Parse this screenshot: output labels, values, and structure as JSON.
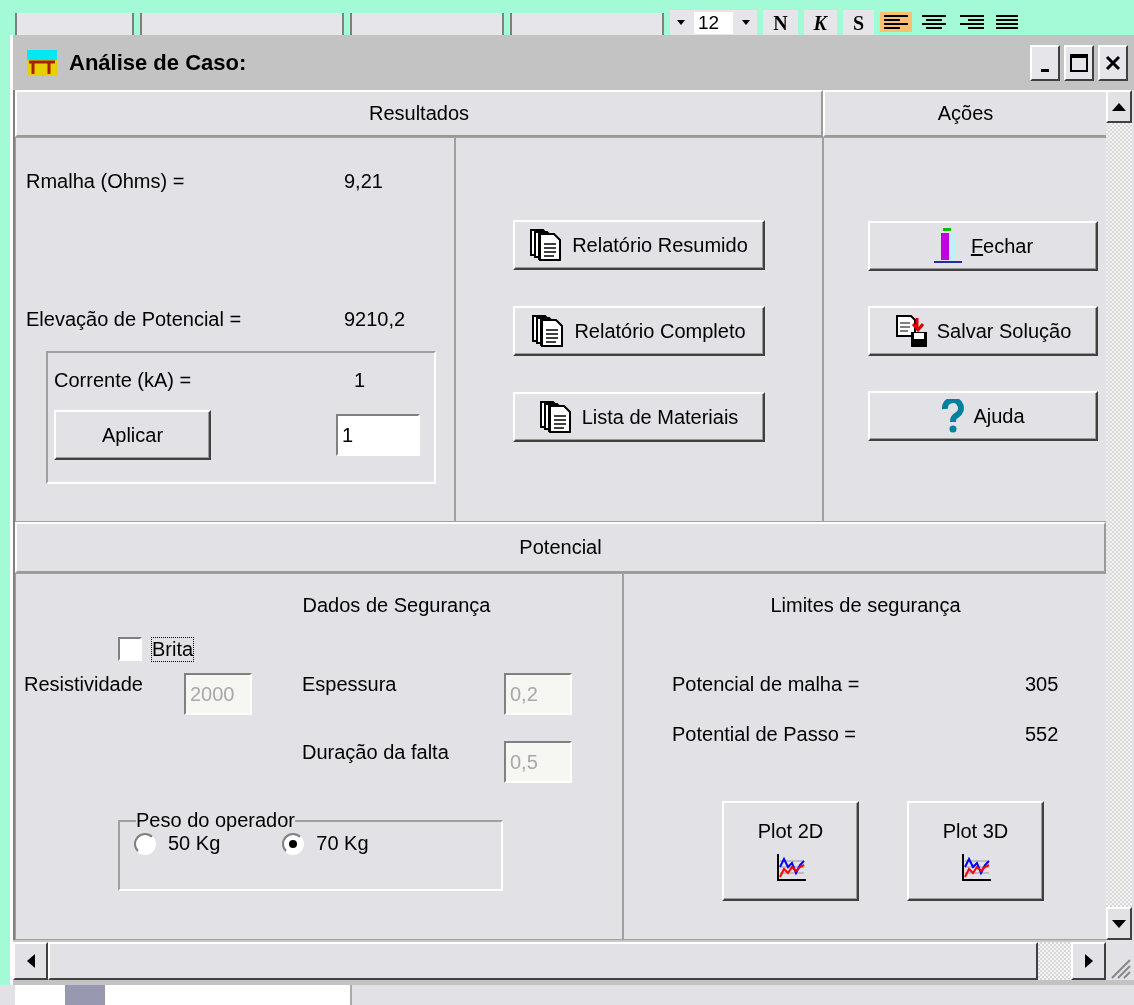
{
  "toolbar": {
    "font_size": "12",
    "bold": "N",
    "italic": "K",
    "underline": "S"
  },
  "window": {
    "title": "Análise de Caso:"
  },
  "resultados": {
    "header": "Resultados",
    "rows": [
      {
        "label": "Rmalha (Ohms) =",
        "value": "9,21"
      },
      {
        "label": "Elevação de Potencial =",
        "value": "9210,2"
      }
    ],
    "corrente": {
      "label": "Corrente (kA) =",
      "value": "1",
      "apply_button": "Aplicar",
      "input_value": "1"
    },
    "report_buttons": [
      "Relatório Resumido",
      "Relatório Completo",
      "Lista de Materiais"
    ]
  },
  "acoes": {
    "header": "Ações",
    "buttons": [
      {
        "kind": "close",
        "key": "F",
        "rest": "echar"
      },
      {
        "kind": "save",
        "rest": "Salvar Solução"
      },
      {
        "kind": "help",
        "rest": "Ajuda"
      }
    ]
  },
  "potencial": {
    "header": "Potencial",
    "dados": {
      "title": "Dados de Segurança",
      "brita": {
        "label": "Brita",
        "checked": false
      },
      "fields": [
        {
          "label": "Resistividade",
          "value": "2000",
          "disabled": true
        },
        {
          "label": "Espessura",
          "value": "0,2",
          "disabled": true
        },
        {
          "label": "Duração da falta",
          "value": "0,5",
          "disabled": true
        }
      ],
      "peso": {
        "legend": "Peso do operador",
        "options": [
          {
            "label": "50 Kg",
            "selected": false
          },
          {
            "label": "70 Kg",
            "selected": true
          }
        ]
      }
    },
    "limites": {
      "title": "Limites de segurança",
      "rows": [
        {
          "label": "Potencial de malha =",
          "value": "305"
        },
        {
          "label": "Potential de Passo =",
          "value": "552"
        }
      ],
      "plot_buttons": [
        "Plot 2D",
        "Plot 3D"
      ]
    }
  }
}
